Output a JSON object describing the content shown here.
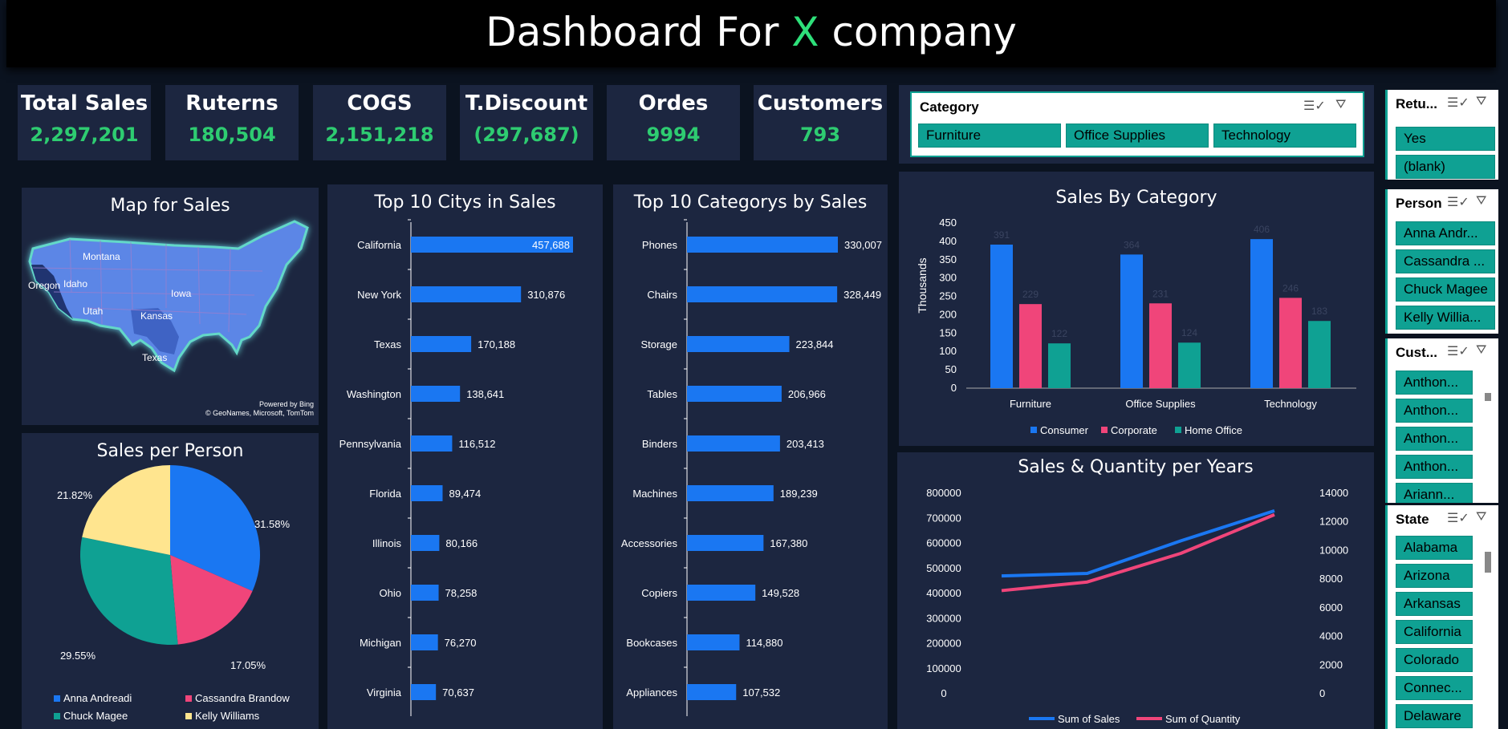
{
  "header": {
    "title_prefix": "Dashboard For ",
    "title_x": "X",
    "title_suffix": " company"
  },
  "kpis": [
    {
      "label": "Total Sales",
      "value": "2,297,201"
    },
    {
      "label": "Ruterns",
      "value": "180,504"
    },
    {
      "label": "COGS",
      "value": "2,151,218"
    },
    {
      "label": "T.Discount",
      "value": "(297,687)"
    },
    {
      "label": "Ordes",
      "value": "9994"
    },
    {
      "label": "Customers",
      "value": "793"
    }
  ],
  "map": {
    "title": "Map for Sales",
    "labels": [
      "Montana",
      "Oregon",
      "Idaho",
      "Iowa",
      "Utah",
      "Kansas",
      "Texas"
    ],
    "credit1": "Powered by Bing",
    "credit2": "© GeoNames, Microsoft, TomTom"
  },
  "colors": {
    "blue": "#1a77f2",
    "pink": "#f0457a",
    "teal": "#0fa193",
    "yellow": "#ffe58f",
    "green": "#2ecc71"
  },
  "icons": {
    "multiselect": "multi-select-icon",
    "clear_filter": "clear-filter-icon"
  },
  "slicers": {
    "category": {
      "title": "Category",
      "items": [
        "Furniture",
        "Office Supplies",
        "Technology"
      ]
    },
    "returns": {
      "title": "Retu...",
      "items": [
        "Yes",
        "(blank)"
      ]
    },
    "person": {
      "title": "Person",
      "items": [
        "Anna Andr...",
        "Cassandra ...",
        "Chuck Magee",
        "Kelly Willia..."
      ]
    },
    "customer": {
      "title": "Cust...",
      "items": [
        "Anthon...",
        "Anthon...",
        "Anthon...",
        "Anthon...",
        "Ariann..."
      ]
    },
    "state": {
      "title": "State",
      "items": [
        "Alabama",
        "Arizona",
        "Arkansas",
        "California",
        "Colorado",
        "Connec...",
        "Delaware"
      ]
    }
  },
  "chart_data": [
    {
      "id": "pie",
      "type": "pie",
      "title": "Sales per Person",
      "categories": [
        "Anna Andreadi",
        "Cassandra Brandow",
        "Chuck Magee",
        "Kelly Williams"
      ],
      "values": [
        31.58,
        17.05,
        29.55,
        21.82
      ],
      "labels": [
        "31.58%",
        "17.05%",
        "29.55%",
        "21.82%"
      ],
      "legend": "bottom"
    },
    {
      "id": "cities",
      "type": "bar",
      "title": "Top 10 Citys in Sales",
      "categories": [
        "California",
        "New York",
        "Texas",
        "Washington",
        "Pennsylvania",
        "Florida",
        "Illinois",
        "Ohio",
        "Michigan",
        "Virginia"
      ],
      "values": [
        457688,
        310876,
        170188,
        138641,
        116512,
        89474,
        80166,
        78258,
        76270,
        70637
      ],
      "labels": [
        "457,688",
        "310,876",
        "170,188",
        "138,641",
        "116,512",
        "89,474",
        "80,166",
        "78,258",
        "76,270",
        "70,637"
      ]
    },
    {
      "id": "subcats",
      "type": "bar",
      "title": "Top 10 Categorys by Sales",
      "categories": [
        "Phones",
        "Chairs",
        "Storage",
        "Tables",
        "Binders",
        "Machines",
        "Accessories",
        "Copiers",
        "Bookcases",
        "Appliances"
      ],
      "values": [
        330007,
        328449,
        223844,
        206966,
        203413,
        189239,
        167380,
        149528,
        114880,
        107532
      ],
      "labels": [
        "330,007",
        "328,449",
        "223,844",
        "206,966",
        "203,413",
        "189,239",
        "167,380",
        "149,528",
        "114,880",
        "107,532"
      ]
    },
    {
      "id": "bycat",
      "type": "bar",
      "title": "Sales By Category",
      "ylabel": "Thousands",
      "categories": [
        "Furniture",
        "Office Supplies",
        "Technology"
      ],
      "series": [
        {
          "name": "Consumer",
          "values": [
            391,
            364,
            406
          ]
        },
        {
          "name": "Corporate",
          "values": [
            229,
            231,
            246
          ]
        },
        {
          "name": "Home Office",
          "values": [
            122,
            124,
            183
          ]
        }
      ],
      "ylim": [
        0,
        450
      ],
      "yticks": [
        "450",
        "400",
        "350",
        "300",
        "250",
        "200",
        "150",
        "100",
        "50",
        "0"
      ],
      "legend": "bottom"
    },
    {
      "id": "years",
      "type": "line",
      "title": "Sales & Quantity per Years",
      "x": [
        1,
        2,
        3,
        4
      ],
      "series": [
        {
          "name": "Sum of Sales",
          "values": [
            470000,
            480000,
            610000,
            730000
          ],
          "axis": "left"
        },
        {
          "name": "Sum of Quantity",
          "values": [
            7200,
            7800,
            9800,
            12500
          ],
          "axis": "right"
        }
      ],
      "ylim": [
        0,
        800000
      ],
      "y2lim": [
        0,
        14000
      ],
      "yticks": [
        "800000",
        "700000",
        "600000",
        "500000",
        "400000",
        "300000",
        "200000",
        "100000",
        "0"
      ],
      "y2ticks": [
        "14000",
        "12000",
        "10000",
        "8000",
        "6000",
        "4000",
        "2000",
        "0"
      ],
      "legend": "bottom"
    }
  ]
}
